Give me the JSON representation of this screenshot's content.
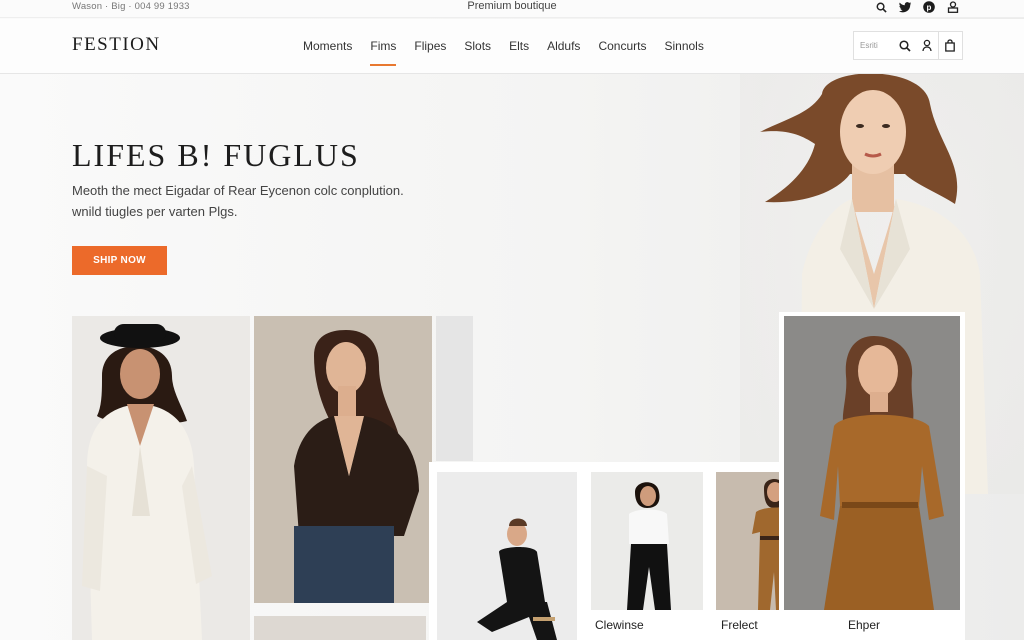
{
  "topbar": {
    "contact": "Wason · Big  ·  004 99 1933",
    "tagline": "Premium boutique",
    "icons": [
      "search-icon",
      "twitter-icon",
      "pinterest-icon",
      "user-icon"
    ]
  },
  "nav": {
    "logo": "FESTION",
    "items": [
      {
        "label": "Moments",
        "active": false
      },
      {
        "label": "Fims",
        "active": true
      },
      {
        "label": "Flipes",
        "active": false
      },
      {
        "label": "Slots",
        "active": false
      },
      {
        "label": "Elts",
        "active": false
      },
      {
        "label": "Aldufs",
        "active": false
      },
      {
        "label": "Concurts",
        "active": false
      },
      {
        "label": "Sinnols",
        "active": false
      }
    ],
    "search_placeholder": "Esriti"
  },
  "hero": {
    "title": "LIFES B! FUGLUS",
    "subtitle": "Meoth the mect Eigadar of Rear Eycenon colc conplution. wnild tiugles per varten Plgs.",
    "cta": "SHIP NOW"
  },
  "products": [
    {
      "caption": "Clewinse"
    },
    {
      "caption": "Frelect"
    },
    {
      "caption": "Ehper"
    }
  ],
  "colors": {
    "accent": "#ec6a2a",
    "nav_underline": "#e87830"
  }
}
